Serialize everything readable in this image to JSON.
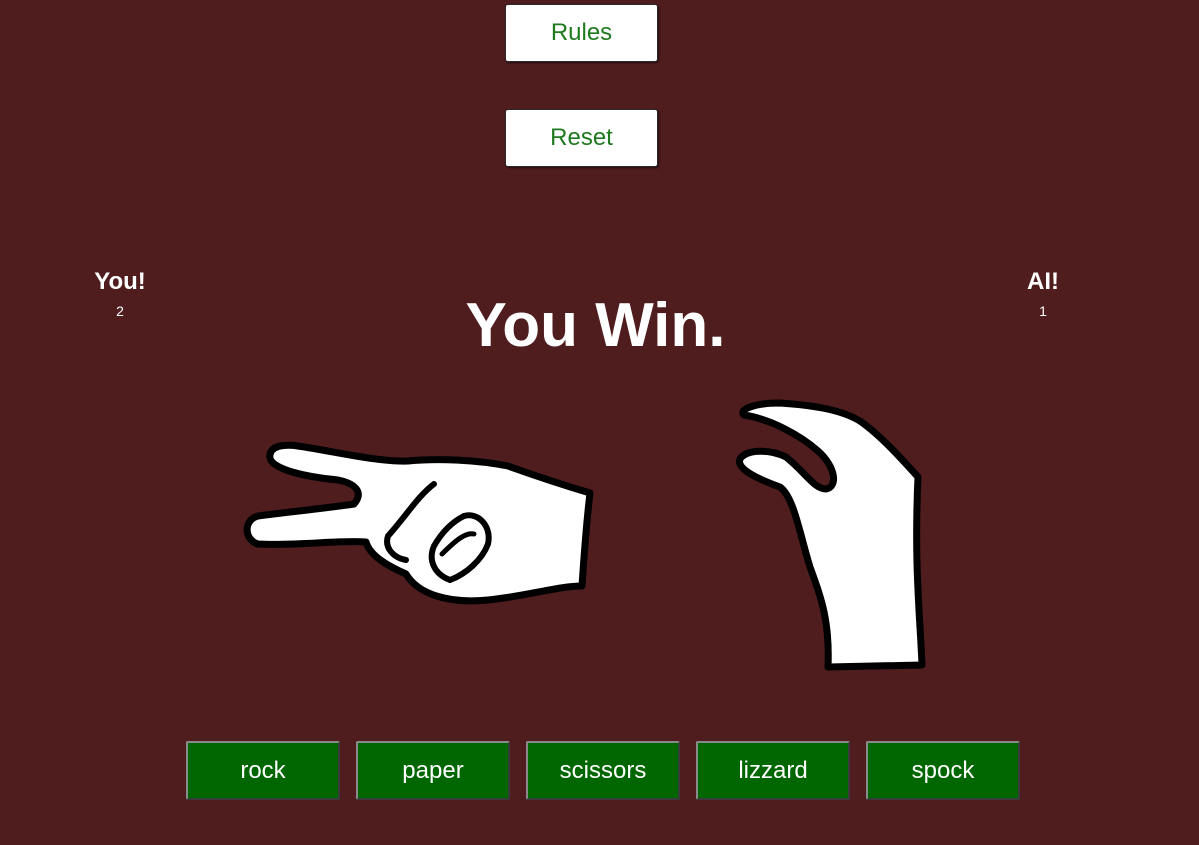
{
  "controls": {
    "rules_label": "Rules",
    "reset_label": "Reset"
  },
  "scoreboard": {
    "player": {
      "title": "You!",
      "score": "2"
    },
    "ai": {
      "title": "AI!",
      "score": "1"
    }
  },
  "result": {
    "message": "You Win."
  },
  "hands": {
    "player_choice": "scissors-hand-icon",
    "ai_choice": "paper-hand-icon"
  },
  "choices": [
    {
      "label": "rock"
    },
    {
      "label": "paper"
    },
    {
      "label": "scissors"
    },
    {
      "label": "lizzard"
    },
    {
      "label": "spock"
    }
  ],
  "colors": {
    "background": "#501d1f",
    "choice_button": "#006600",
    "top_button_text": "#1f7a1f",
    "text": "#ffffff"
  }
}
